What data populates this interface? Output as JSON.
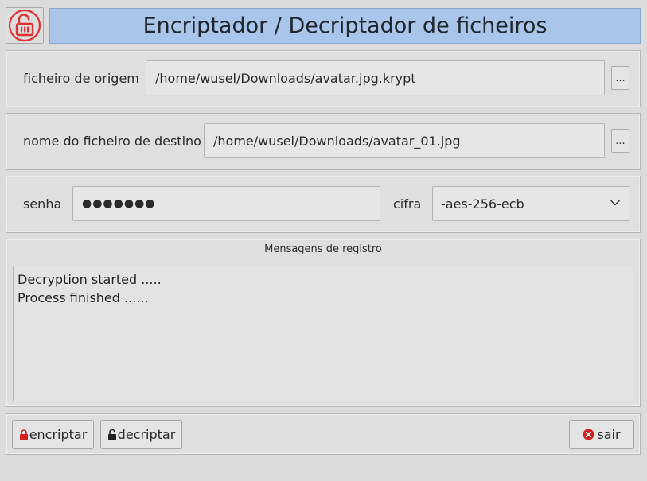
{
  "header": {
    "title": "Encriptador / Decriptador de ficheiros",
    "logo_icon": "unlock-icon",
    "logo_color": "#e03030",
    "title_bg": "#a9c6ea"
  },
  "source": {
    "label": "ficheiro de origem",
    "value": "/home/wusel/Downloads/avatar.jpg.krypt",
    "browse_label": "..."
  },
  "destination": {
    "label": "nome do ficheiro de destino",
    "value": "/home/wusel/Downloads/avatar_01.jpg",
    "browse_label": "..."
  },
  "password": {
    "label": "senha",
    "value": "●●●●●●●"
  },
  "cipher": {
    "label": "cifra",
    "selected": "-aes-256-ecb",
    "arrow_icon": "chevron-down-icon"
  },
  "log": {
    "title": "Mensagens de registro",
    "lines": [
      "Decryption started .....",
      "Process finished ......"
    ]
  },
  "actions": {
    "encrypt_label": "encriptar",
    "encrypt_icon": "lock-icon",
    "decrypt_label": "decriptar",
    "decrypt_icon": "unlock-icon",
    "quit_label": "sair",
    "quit_icon": "close-circle-icon",
    "icon_red": "#d22020"
  }
}
